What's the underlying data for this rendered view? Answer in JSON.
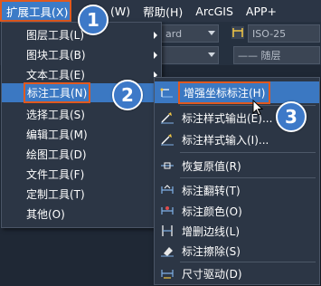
{
  "menubar": {
    "items": [
      {
        "label": "扩展工具(X)",
        "active": true
      },
      {
        "label": "(W)"
      },
      {
        "label": "帮助(H)"
      },
      {
        "label": "ArcGIS"
      },
      {
        "label": "APP+"
      }
    ]
  },
  "toolbar": {
    "style_combo": "ard",
    "font_combo": "ISO-25",
    "layer_combo": "—— 随层"
  },
  "extend_menu": {
    "items": [
      {
        "label": "图层工具(L)",
        "has_submenu": true
      },
      {
        "label": "图块工具(B)",
        "has_submenu": true
      },
      {
        "label": "文本工具(E)",
        "has_submenu": true
      },
      {
        "label": "标注工具(N)",
        "has_submenu": true,
        "highlighted": true
      },
      {
        "label": "选择工具(S)",
        "has_submenu": true
      },
      {
        "label": "编辑工具(M)",
        "has_submenu": true
      },
      {
        "label": "绘图工具(D)",
        "has_submenu": true
      },
      {
        "label": "文件工具(F)",
        "has_submenu": true
      },
      {
        "label": "定制工具(T)",
        "has_submenu": true
      },
      {
        "label": "其他(O)",
        "has_submenu": true
      }
    ]
  },
  "dim_submenu": {
    "items": [
      {
        "label": "增强坐标标注(H)",
        "icon": "coordinate-dim-icon",
        "highlighted": true
      },
      {
        "label": "标注样式输出(E)...",
        "icon": "dimstyle-export-icon"
      },
      {
        "label": "标注样式输入(I)...",
        "icon": "dimstyle-import-icon"
      },
      {
        "label": "恢复原值(R)",
        "icon": "restore-value-icon"
      },
      {
        "label": "标注翻转(T)",
        "icon": "dim-flip-icon"
      },
      {
        "label": "标注颜色(O)",
        "icon": "dim-color-icon"
      },
      {
        "label": "增删边线(L)",
        "icon": "edit-extension-line-icon"
      },
      {
        "label": "标注擦除(S)",
        "icon": "dim-erase-icon"
      },
      {
        "label": "尺寸驱动(D)",
        "icon": "dimension-drive-icon"
      }
    ]
  },
  "badges": {
    "step1": "1",
    "step2": "2",
    "step3": "3"
  },
  "colors": {
    "highlight": "#3b78c2",
    "callout_border": "#e0591f",
    "badge": "#3d79c8",
    "menu_bg": "#2c3645"
  }
}
